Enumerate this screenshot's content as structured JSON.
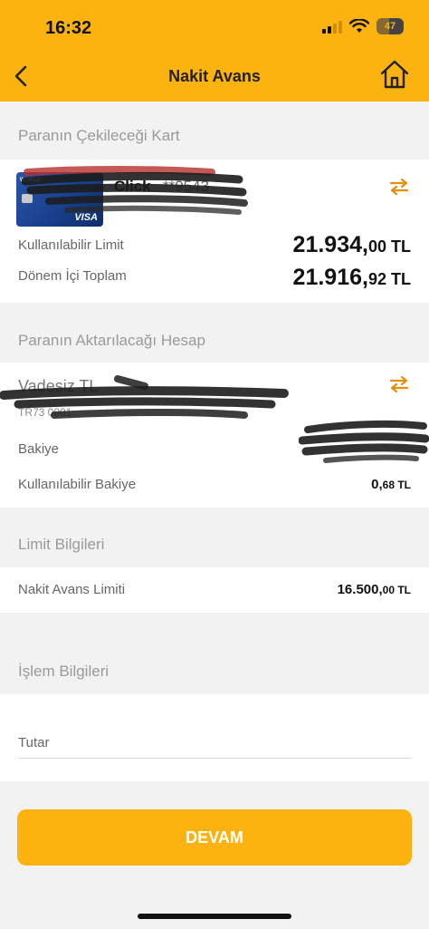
{
  "status_bar": {
    "time": "16:32",
    "battery": "47"
  },
  "header": {
    "title": "Nakit Avans"
  },
  "card_section": {
    "title": "Paranın Çekileceği Kart",
    "card_brand_small": "WORLD",
    "card_network": "VISA",
    "card_name": "Click",
    "card_number": "**9543",
    "available_limit_label": "Kullanılabilir Limit",
    "available_limit_int": "21.934,",
    "available_limit_dec": "00",
    "available_limit_cur": " TL",
    "period_total_label": "Dönem İçi Toplam",
    "period_total_int": "21.916,",
    "period_total_dec": "92",
    "period_total_cur": " TL"
  },
  "account_section": {
    "title": "Paranın Aktarılacağı Hesap",
    "account_name": "Vadesiz TL",
    "account_no": "TR73 0001",
    "balance_label": "Bakiye",
    "available_balance_label": "Kullanılabilir Bakiye",
    "available_balance_int": "0,",
    "available_balance_dec": "68",
    "available_balance_cur": " TL"
  },
  "limit_section": {
    "title": "Limit Bilgileri",
    "cash_advance_limit_label": "Nakit Avans Limiti",
    "cash_advance_limit_int": "16.500,",
    "cash_advance_limit_dec": "00",
    "cash_advance_limit_cur": " TL"
  },
  "transaction_section": {
    "title": "İşlem Bilgileri",
    "amount_label": "Tutar"
  },
  "actions": {
    "continue_label": "DEVAM"
  },
  "colors": {
    "accent": "#fcb20f",
    "swap_icon": "#e5900b"
  }
}
